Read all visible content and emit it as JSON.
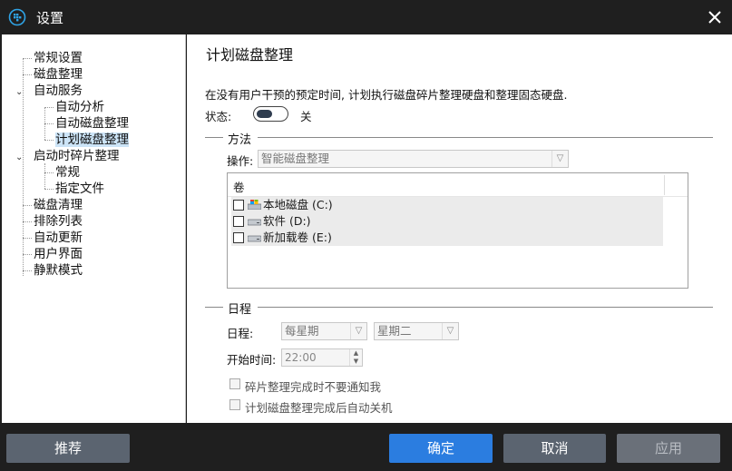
{
  "window": {
    "title": "设置"
  },
  "sidebar": {
    "items": [
      {
        "label": "常规设置",
        "level": 0
      },
      {
        "label": "磁盘整理",
        "level": 0
      },
      {
        "label": "自动服务",
        "level": 0,
        "expanded": true
      },
      {
        "label": "自动分析",
        "level": 1
      },
      {
        "label": "自动磁盘整理",
        "level": 1
      },
      {
        "label": "计划磁盘整理",
        "level": 1,
        "selected": true
      },
      {
        "label": "启动时碎片整理",
        "level": 0,
        "expanded": true
      },
      {
        "label": "常规",
        "level": 1
      },
      {
        "label": "指定文件",
        "level": 1
      },
      {
        "label": "磁盘清理",
        "level": 0
      },
      {
        "label": "排除列表",
        "level": 0
      },
      {
        "label": "自动更新",
        "level": 0
      },
      {
        "label": "用户界面",
        "level": 0
      },
      {
        "label": "静默模式",
        "level": 0
      }
    ]
  },
  "main": {
    "title": "计划磁盘整理",
    "description": "在没有用户干预的预定时间, 计划执行磁盘碎片整理硬盘和整理固态硬盘.",
    "status_label": "状态:",
    "status_value": "关",
    "method": {
      "heading": "方法",
      "operation_label": "操作:",
      "operation_value": "智能磁盘整理",
      "volumes_header": "卷",
      "volumes": [
        {
          "name": "本地磁盘 (C:)",
          "icon": "windows-drive-icon"
        },
        {
          "name": "软件 (D:)",
          "icon": "drive-icon"
        },
        {
          "name": "新加载卷 (E:)",
          "icon": "drive-icon"
        }
      ]
    },
    "schedule": {
      "heading": "日程",
      "schedule_label": "日程:",
      "frequency": "每星期",
      "day": "星期二",
      "start_label": "开始时间:",
      "start_time": "22:00",
      "no_notify": "碎片整理完成时不要通知我",
      "auto_shutdown": "计划磁盘整理完成后自动关机"
    }
  },
  "footer": {
    "recommend": "推荐",
    "ok": "确定",
    "cancel": "取消",
    "apply": "应用"
  },
  "colors": {
    "accent": "#2b7de0",
    "titlebar": "#1f1f1f",
    "selection": "#cce4f7"
  }
}
